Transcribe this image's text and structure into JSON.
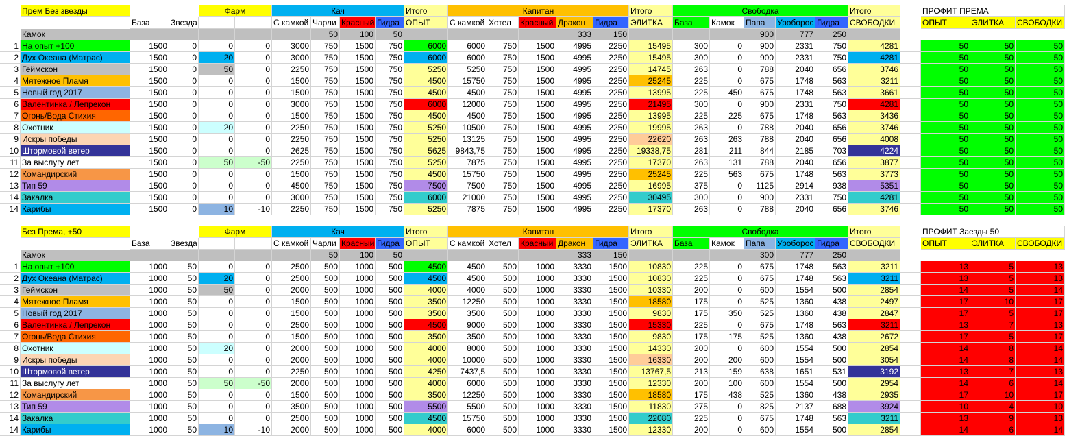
{
  "colors": {
    "yellow": "#ffff00",
    "gold": "#ffc000",
    "cyan": "#00b0f0",
    "teal": "#4bacc6",
    "lightyellow": "#ffff99",
    "green": "#00cc00",
    "green2": "#00ff00",
    "sky": "#00b0f0",
    "gray": "#bfbfbf",
    "amber": "#ffc000",
    "lightblue": "#8db4e2",
    "red": "#ff0000",
    "orange": "#ff6600",
    "lightcyan": "#ccffff",
    "peach": "#fcd5b4",
    "navy": "#333399",
    "white": "#ffffff",
    "darkorange": "#f79646",
    "lavender": "#b18be8",
    "turq": "#33cccc",
    "lightgreen": "#ccffcc",
    "blue": "#3366ff",
    "paleorange": "#ffcc99",
    "brightgreen": "#00ff00"
  },
  "block1": {
    "title": "Прем Без звезды",
    "group_farm": "Фарм",
    "group_kach": "Кач",
    "itogo1": "Итого",
    "group_capitan": "Капитан",
    "itogo2": "Итого",
    "group_svobodka": "Свободка",
    "itogo3": "Итого",
    "profit_title": "ПРОФИТ ПРЕМА",
    "headers": [
      "База",
      "Звезда",
      "",
      "",
      "С камкой",
      "Чарли",
      "Красный",
      "Гидра",
      "ОПЫТ",
      "С камкой",
      "Хотел",
      "Красный",
      "Дракон",
      "Гидра",
      "ЭЛИТКА",
      "База",
      "Камок",
      "Папа",
      "Уроборос",
      "Гидра",
      "СВОБОДКИ"
    ],
    "profit_headers": [
      "ОПЫТ",
      "ЭЛИТКА",
      "СВОБОДКИ"
    ],
    "kamok_label": "Камок",
    "kamok_vals": [
      "50",
      "100",
      "50",
      "",
      "",
      "",
      "333",
      "150",
      "",
      "",
      "",
      "900",
      "777",
      "250"
    ],
    "rows": [
      [
        "1",
        "На опыт +100",
        "1500",
        "0",
        "0",
        "0",
        "3000",
        "750",
        "1500",
        "750",
        "6000",
        "6000",
        "750",
        "1500",
        "4995",
        "2250",
        "15495",
        "300",
        "0",
        "900",
        "2331",
        "750",
        "4281",
        "50",
        "50",
        "50"
      ],
      [
        "2",
        "Дух Океана (Матрас)",
        "1500",
        "0",
        "20",
        "0",
        "3000",
        "750",
        "1500",
        "750",
        "6000",
        "6000",
        "750",
        "1500",
        "4995",
        "2250",
        "15495",
        "300",
        "0",
        "900",
        "2331",
        "750",
        "4281",
        "50",
        "50",
        "50"
      ],
      [
        "3",
        "Геймскон",
        "1500",
        "0",
        "50",
        "0",
        "2250",
        "750",
        "1500",
        "750",
        "5250",
        "5250",
        "750",
        "1500",
        "4995",
        "2250",
        "14745",
        "263",
        "0",
        "788",
        "2040",
        "656",
        "3746",
        "50",
        "50",
        "50"
      ],
      [
        "4",
        "Мятежное Пламя",
        "1500",
        "0",
        "0",
        "0",
        "1500",
        "750",
        "1500",
        "750",
        "4500",
        "15750",
        "750",
        "1500",
        "4995",
        "2250",
        "25245",
        "225",
        "0",
        "675",
        "1748",
        "563",
        "3211",
        "50",
        "50",
        "50"
      ],
      [
        "5",
        "Новый год 2017",
        "1500",
        "0",
        "0",
        "0",
        "1500",
        "750",
        "1500",
        "750",
        "4500",
        "4500",
        "750",
        "1500",
        "4995",
        "2250",
        "13995",
        "225",
        "450",
        "675",
        "1748",
        "563",
        "3661",
        "50",
        "50",
        "50"
      ],
      [
        "6",
        "Валентинка / Лепрекон",
        "1500",
        "0",
        "0",
        "0",
        "3000",
        "750",
        "1500",
        "750",
        "6000",
        "12000",
        "750",
        "1500",
        "4995",
        "2250",
        "21495",
        "300",
        "0",
        "900",
        "2331",
        "750",
        "4281",
        "50",
        "50",
        "50"
      ],
      [
        "7",
        "Огонь/Вода Стихия",
        "1500",
        "0",
        "0",
        "0",
        "1500",
        "750",
        "1500",
        "750",
        "4500",
        "4500",
        "750",
        "1500",
        "4995",
        "2250",
        "13995",
        "225",
        "225",
        "675",
        "1748",
        "563",
        "3436",
        "50",
        "50",
        "50"
      ],
      [
        "8",
        "Охотник",
        "1500",
        "0",
        "20",
        "0",
        "2250",
        "750",
        "1500",
        "750",
        "5250",
        "10500",
        "750",
        "1500",
        "4995",
        "2250",
        "19995",
        "263",
        "0",
        "788",
        "2040",
        "656",
        "3746",
        "50",
        "50",
        "50"
      ],
      [
        "9",
        "Искры победы",
        "1500",
        "0",
        "0",
        "0",
        "2250",
        "750",
        "1500",
        "750",
        "5250",
        "13125",
        "750",
        "1500",
        "4995",
        "2250",
        "22620",
        "263",
        "263",
        "788",
        "2040",
        "656",
        "4008",
        "50",
        "50",
        "50"
      ],
      [
        "10",
        "Штормовой ветер",
        "1500",
        "0",
        "0",
        "0",
        "2625",
        "750",
        "1500",
        "750",
        "5625",
        "9843,75",
        "750",
        "1500",
        "4995",
        "2250",
        "19338,75",
        "281",
        "211",
        "844",
        "2185",
        "703",
        "4224",
        "50",
        "50",
        "50"
      ],
      [
        "11",
        "За выслугу лет",
        "1500",
        "0",
        "50",
        "-50",
        "2250",
        "750",
        "1500",
        "750",
        "5250",
        "7875",
        "750",
        "1500",
        "4995",
        "2250",
        "17370",
        "263",
        "131",
        "788",
        "2040",
        "656",
        "3877",
        "50",
        "50",
        "50"
      ],
      [
        "12",
        "Командирский",
        "1500",
        "0",
        "0",
        "0",
        "1500",
        "750",
        "1500",
        "750",
        "4500",
        "15750",
        "750",
        "1500",
        "4995",
        "2250",
        "25245",
        "225",
        "563",
        "675",
        "1748",
        "563",
        "3773",
        "50",
        "50",
        "50"
      ],
      [
        "13",
        "Тип 59",
        "1500",
        "0",
        "0",
        "0",
        "4500",
        "750",
        "1500",
        "750",
        "7500",
        "7500",
        "750",
        "1500",
        "4995",
        "2250",
        "16995",
        "375",
        "0",
        "1125",
        "2914",
        "938",
        "5351",
        "50",
        "50",
        "50"
      ],
      [
        "14",
        "Закалка",
        "1500",
        "0",
        "0",
        "0",
        "3000",
        "750",
        "1500",
        "750",
        "6000",
        "21000",
        "750",
        "1500",
        "4995",
        "2250",
        "30495",
        "300",
        "0",
        "900",
        "2331",
        "750",
        "4281",
        "50",
        "50",
        "50"
      ],
      [
        "14",
        "Карибы",
        "1500",
        "0",
        "10",
        "-10",
        "2250",
        "750",
        "1500",
        "750",
        "5250",
        "7875",
        "750",
        "1500",
        "4995",
        "2250",
        "17370",
        "263",
        "0",
        "788",
        "2040",
        "656",
        "3746",
        "50",
        "50",
        "50"
      ]
    ]
  },
  "block2": {
    "title": "Без Према, +50",
    "group_farm": "Фарм",
    "group_kach": "Кач",
    "itogo1": "Итого",
    "group_capitan": "Капитан",
    "itogo2": "Итого",
    "group_svobodka": "Свободка",
    "itogo3": "Итого",
    "profit_title": "ПРОФИТ Заезды 50",
    "headers": [
      "База",
      "Звезда",
      "",
      "",
      "С камкой",
      "Чарли",
      "Красный",
      "Гидра",
      "ОПЫТ",
      "С камкой",
      "Хотел",
      "Красный",
      "Дракон",
      "Гидра",
      "ЭЛИТКА",
      "База",
      "Камок",
      "Папа",
      "Уроборос",
      "Гидра",
      "СВОБОДКИ"
    ],
    "profit_headers": [
      "ОПЫТ",
      "ЭЛИТКА",
      "СВОБОДКИ"
    ],
    "kamok_label": "Камок",
    "kamok_vals": [
      "50",
      "100",
      "50",
      "",
      "",
      "",
      "333",
      "150",
      "",
      "",
      "",
      "300",
      "777",
      "250"
    ],
    "rows": [
      [
        "1",
        "На опыт +100",
        "1000",
        "50",
        "0",
        "0",
        "2500",
        "500",
        "1000",
        "500",
        "4500",
        "4500",
        "500",
        "1000",
        "3330",
        "1500",
        "10830",
        "225",
        "0",
        "675",
        "1748",
        "563",
        "3211",
        "13",
        "5",
        "13"
      ],
      [
        "2",
        "Дух Океана (Матрас)",
        "1000",
        "50",
        "20",
        "0",
        "2500",
        "500",
        "1000",
        "500",
        "4500",
        "4500",
        "500",
        "1000",
        "3330",
        "1500",
        "10830",
        "225",
        "0",
        "675",
        "1748",
        "563",
        "3211",
        "13",
        "5",
        "13"
      ],
      [
        "3",
        "Геймскон",
        "1000",
        "50",
        "50",
        "0",
        "2000",
        "500",
        "1000",
        "500",
        "4000",
        "4000",
        "500",
        "1000",
        "3330",
        "1500",
        "10330",
        "200",
        "0",
        "600",
        "1554",
        "500",
        "2854",
        "14",
        "5",
        "14"
      ],
      [
        "4",
        "Мятежное Пламя",
        "1000",
        "50",
        "0",
        "0",
        "1500",
        "500",
        "1000",
        "500",
        "3500",
        "12250",
        "500",
        "1000",
        "3330",
        "1500",
        "18580",
        "175",
        "0",
        "525",
        "1360",
        "438",
        "2497",
        "17",
        "10",
        "17"
      ],
      [
        "5",
        "Новый год 2017",
        "1000",
        "50",
        "0",
        "0",
        "1500",
        "500",
        "1000",
        "500",
        "3500",
        "3500",
        "500",
        "1000",
        "3330",
        "1500",
        "9830",
        "175",
        "350",
        "525",
        "1360",
        "438",
        "2847",
        "17",
        "5",
        "17"
      ],
      [
        "6",
        "Валентинка / Лепрекон",
        "1000",
        "50",
        "0",
        "0",
        "2500",
        "500",
        "1000",
        "500",
        "4500",
        "9000",
        "500",
        "1000",
        "3330",
        "1500",
        "15330",
        "225",
        "0",
        "675",
        "1748",
        "563",
        "3211",
        "13",
        "7",
        "13"
      ],
      [
        "7",
        "Огонь/Вода Стихия",
        "1000",
        "50",
        "0",
        "0",
        "1500",
        "500",
        "1000",
        "500",
        "3500",
        "3500",
        "500",
        "1000",
        "3330",
        "1500",
        "9830",
        "175",
        "175",
        "525",
        "1360",
        "438",
        "2672",
        "17",
        "5",
        "17"
      ],
      [
        "8",
        "Охотник",
        "1000",
        "50",
        "20",
        "0",
        "2000",
        "500",
        "1000",
        "500",
        "4000",
        "8000",
        "500",
        "1000",
        "3330",
        "1500",
        "14330",
        "200",
        "0",
        "600",
        "1554",
        "500",
        "2854",
        "14",
        "8",
        "14"
      ],
      [
        "9",
        "Искры победы",
        "1000",
        "50",
        "0",
        "0",
        "2000",
        "500",
        "1000",
        "500",
        "4000",
        "10000",
        "500",
        "1000",
        "3330",
        "1500",
        "16330",
        "200",
        "200",
        "600",
        "1554",
        "500",
        "3054",
        "14",
        "8",
        "14"
      ],
      [
        "10",
        "Штормовой ветер",
        "1000",
        "50",
        "0",
        "0",
        "2250",
        "500",
        "1000",
        "500",
        "4250",
        "7437,5",
        "500",
        "1000",
        "3330",
        "1500",
        "13767,5",
        "213",
        "159",
        "638",
        "1651",
        "531",
        "3192",
        "13",
        "7",
        "13"
      ],
      [
        "11",
        "За выслугу лет",
        "1000",
        "50",
        "50",
        "-50",
        "2000",
        "500",
        "1000",
        "500",
        "4000",
        "6000",
        "500",
        "1000",
        "3330",
        "1500",
        "12330",
        "200",
        "100",
        "600",
        "1554",
        "500",
        "2954",
        "14",
        "6",
        "14"
      ],
      [
        "12",
        "Командирский",
        "1000",
        "50",
        "0",
        "0",
        "1500",
        "500",
        "1000",
        "500",
        "3500",
        "12250",
        "500",
        "1000",
        "3330",
        "1500",
        "18580",
        "175",
        "438",
        "525",
        "1360",
        "438",
        "2935",
        "17",
        "10",
        "17"
      ],
      [
        "13",
        "Тип 59",
        "1000",
        "50",
        "0",
        "0",
        "3500",
        "500",
        "1000",
        "500",
        "5500",
        "5500",
        "500",
        "1000",
        "3330",
        "1500",
        "11830",
        "275",
        "0",
        "825",
        "2137",
        "688",
        "3924",
        "10",
        "4",
        "10"
      ],
      [
        "14",
        "Закалка",
        "1000",
        "50",
        "0",
        "0",
        "2500",
        "500",
        "1000",
        "500",
        "4500",
        "15750",
        "500",
        "1000",
        "3330",
        "1500",
        "22080",
        "225",
        "0",
        "675",
        "1748",
        "563",
        "3211",
        "13",
        "9",
        "13"
      ],
      [
        "14",
        "Карибы",
        "1000",
        "50",
        "10",
        "-10",
        "2000",
        "500",
        "1000",
        "500",
        "4000",
        "6000",
        "500",
        "1000",
        "3330",
        "1500",
        "12330",
        "200",
        "0",
        "600",
        "1554",
        "500",
        "2854",
        "14",
        "6",
        "14"
      ]
    ]
  }
}
